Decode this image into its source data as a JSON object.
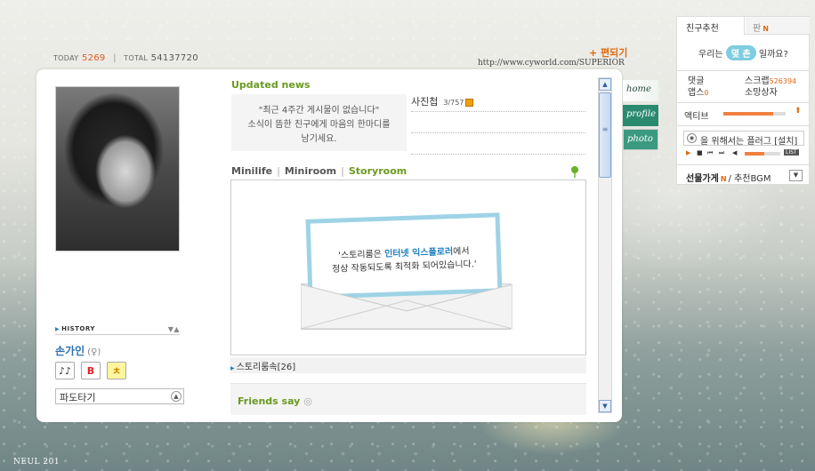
{
  "counter": {
    "today_label": "TODAY",
    "today_value": "5269",
    "total_label": "TOTAL",
    "total_value": "54137720"
  },
  "header": {
    "edit_link": "+ 편되기",
    "url": "http://www.cyworld.com/SUPERIOR"
  },
  "profile": {
    "history_label": "HISTORY",
    "owner_name": "손가인",
    "gender_symbol": "(♀)",
    "badges": [
      "♪♪",
      "B",
      "ㅊ"
    ],
    "select_value": "파도타기"
  },
  "updated": {
    "title": "Updated news",
    "empty_line1": "\"최근 4주간 게시물이 없습니다\"",
    "empty_line2": "소식이 뜸한 친구에게 마음의 한마디를",
    "empty_line3": "남기세요."
  },
  "album": {
    "label": "사진첩",
    "count": "3/757"
  },
  "room_tabs": [
    "Minilife",
    "Miniroom",
    "Storyroom"
  ],
  "story": {
    "line1_prefix": "'스토리룸은 ",
    "line1_highlight": "인터넷 익스플로러",
    "line1_suffix": "에서",
    "line2": "정상 작동되도록 최적화 되어있습니다.'",
    "count_label": "스토리룸속[26]"
  },
  "friends": {
    "title": "Friends say"
  },
  "side_tabs": [
    "home",
    "profile",
    "photo"
  ],
  "right_panel": {
    "tab1": "친구추천",
    "tab2": "판",
    "new_mark": "N",
    "recommend_prefix": "우리는",
    "recommend_pill": "몇 촌",
    "recommend_suffix": "일까요?",
    "comments_label": "댓글",
    "scrap_label": "스크랩",
    "scrap_count": "526394",
    "apps_label": "앱스",
    "apps_count": "0",
    "wish_label": "소망상자",
    "active_label": "액티브",
    "active_level": 0.8,
    "plugin_text": "을 위해서는 플러그 [설치]",
    "volume_level": 0.55,
    "list_label": "LIST",
    "gift_label": "선물가게",
    "gift_suffix": "/ 추천BGM"
  },
  "signature": "NEUL 201"
}
